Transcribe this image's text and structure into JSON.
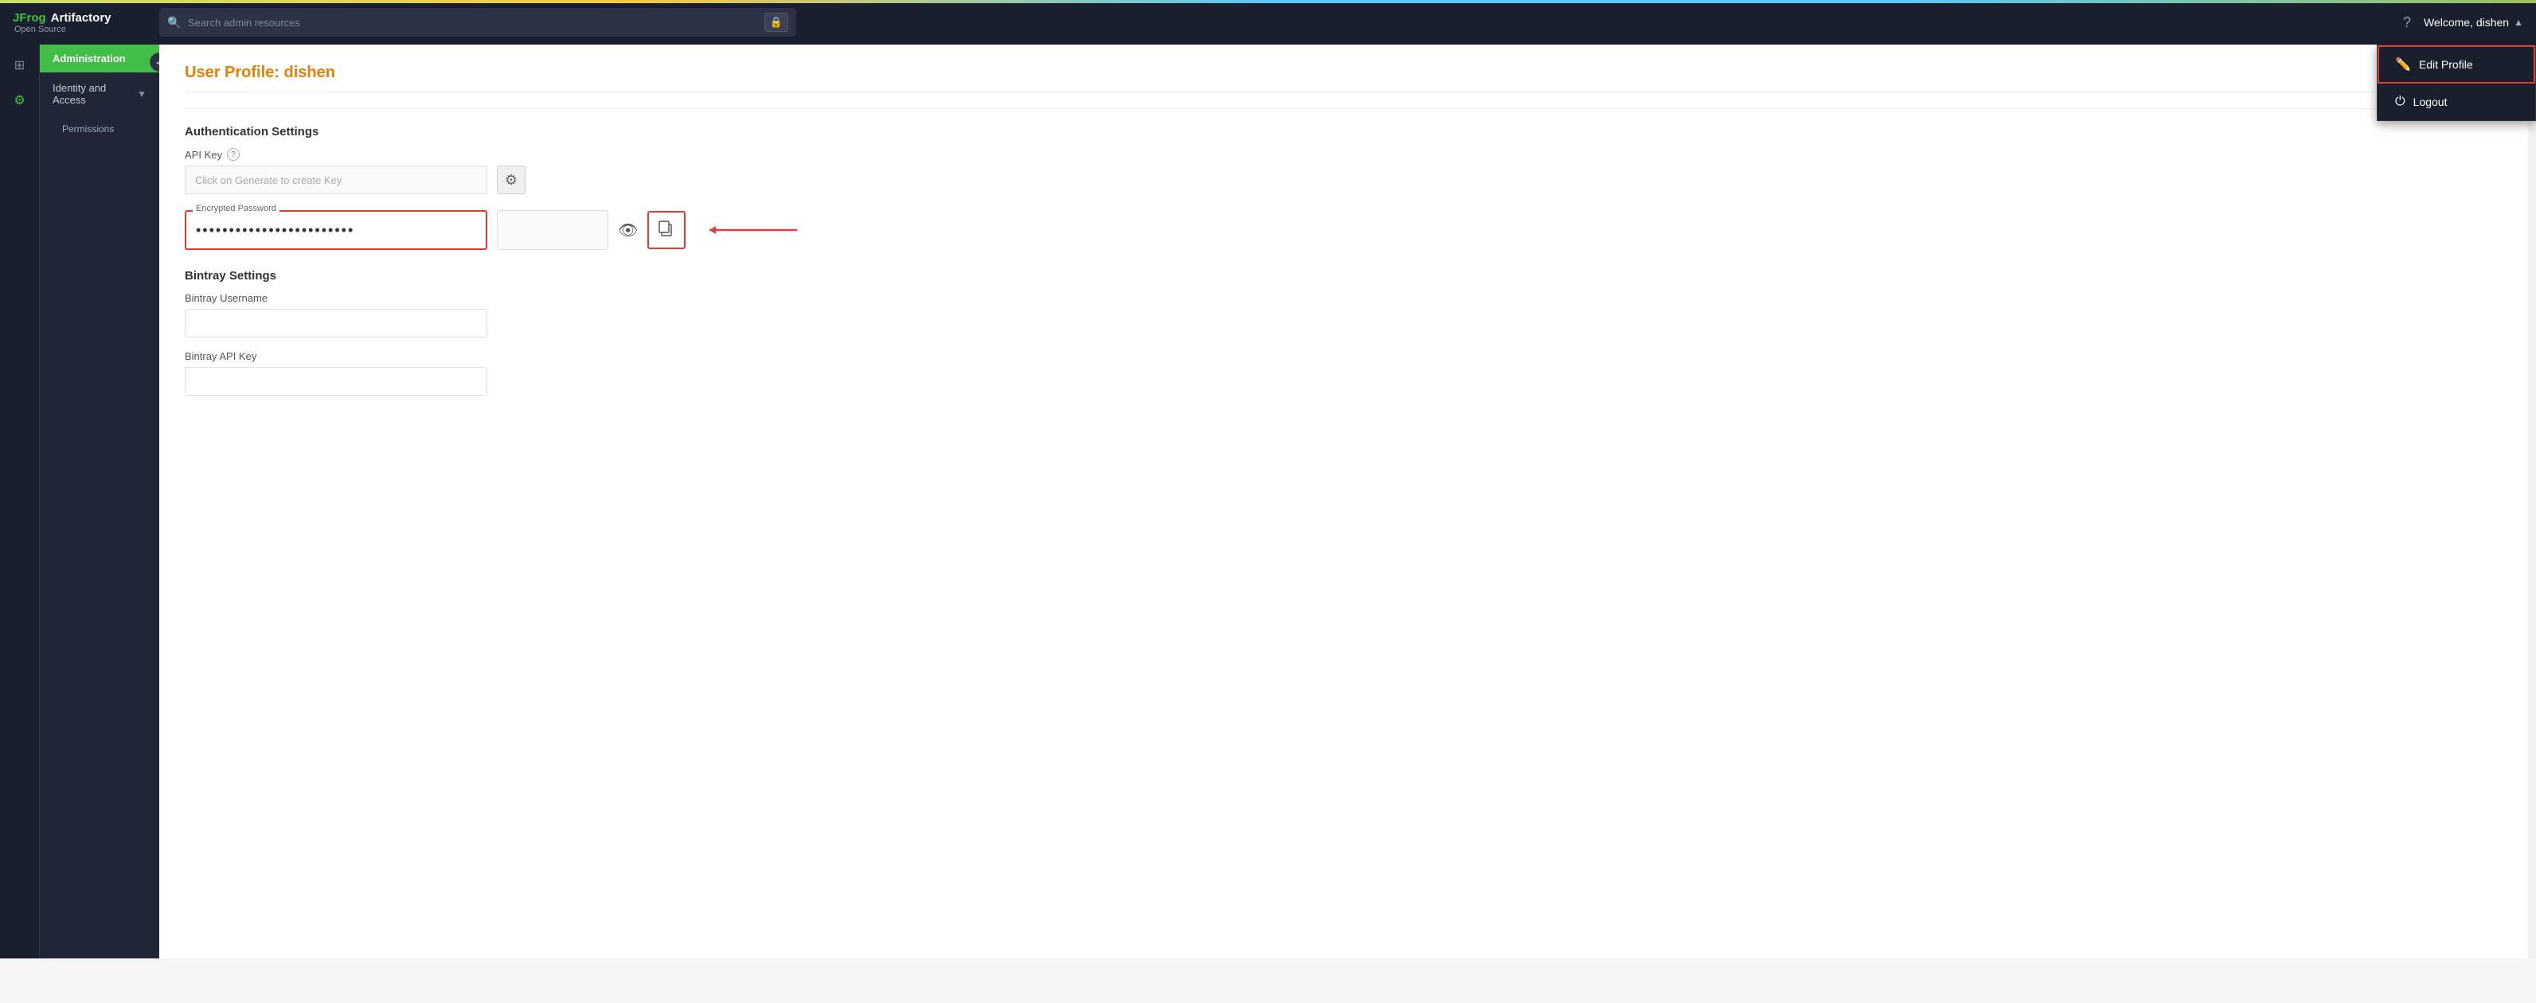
{
  "app": {
    "logo_frog": "JFrog",
    "logo_product": "Artifactory",
    "logo_edition": "Open Source",
    "search_placeholder": "Search admin resources"
  },
  "topnav": {
    "help_icon": "?",
    "welcome_text": "Welcome, dishen",
    "caret": "▲"
  },
  "dropdown": {
    "edit_profile_label": "Edit Profile",
    "logout_label": "Logout"
  },
  "sidebar": {
    "collapse_icon": "◀",
    "admin_label": "Administration",
    "identity_access_label": "Identity and Access",
    "permissions_label": "Permissions"
  },
  "page": {
    "title_prefix": "User Profile: ",
    "title_user": "dishen"
  },
  "auth_settings": {
    "section_title": "Authentication Settings",
    "api_key_label": "API Key",
    "api_key_placeholder": "Click on Generate to create Key",
    "gear_icon": "⚙",
    "encrypted_password_label": "Encrypted Password",
    "encrypted_password_value": "••••••••••••••••••••••••",
    "eye_icon": "👁",
    "copy_icon": "⧉"
  },
  "bintray": {
    "section_title": "Bintray Settings",
    "username_label": "Bintray Username",
    "apikey_label": "Bintray API Key"
  }
}
